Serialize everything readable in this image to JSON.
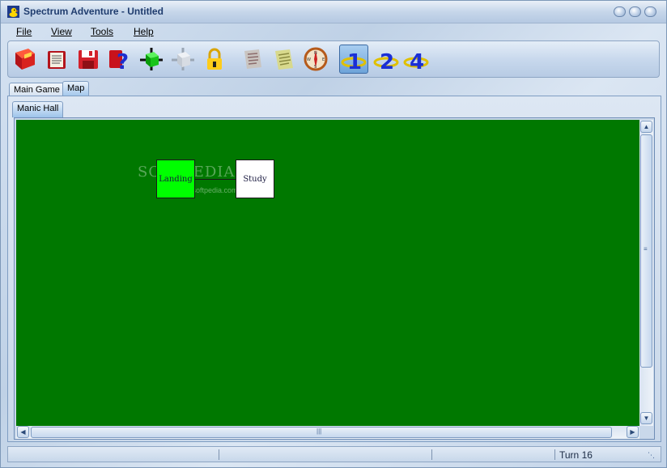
{
  "window": {
    "title": "Spectrum Adventure - Untitled"
  },
  "menu": {
    "file": "File",
    "view": "View",
    "tools": "Tools",
    "help": "Help"
  },
  "toolbar": {
    "buttons": [
      {
        "icon": "new-book-icon"
      },
      {
        "icon": "open-book-icon"
      },
      {
        "icon": "save-disk-icon"
      },
      {
        "icon": "help-icon"
      },
      {
        "icon": "add-room-icon"
      },
      {
        "icon": "remove-room-icon"
      },
      {
        "icon": "lock-icon"
      },
      {
        "icon": "scroll-icon"
      },
      {
        "icon": "notes-icon"
      },
      {
        "icon": "compass-icon"
      },
      {
        "icon": "level-1-icon",
        "label": "1",
        "pressed": true
      },
      {
        "icon": "level-2-icon",
        "label": "2"
      },
      {
        "icon": "level-4-icon",
        "label": "4"
      }
    ]
  },
  "tabs": {
    "main_game": "Main Game",
    "map": "Map",
    "active": "Map"
  },
  "subtabs": {
    "area": "Manic Hall"
  },
  "map": {
    "background": "#007800",
    "rooms": [
      {
        "name": "Landing",
        "color": "#00ff00"
      },
      {
        "name": "Study",
        "color": "#ffffff"
      }
    ],
    "watermark": "SOFTPEDIA",
    "watermark_url": "www.softpedia.com"
  },
  "status": {
    "turn": "Turn 16"
  }
}
